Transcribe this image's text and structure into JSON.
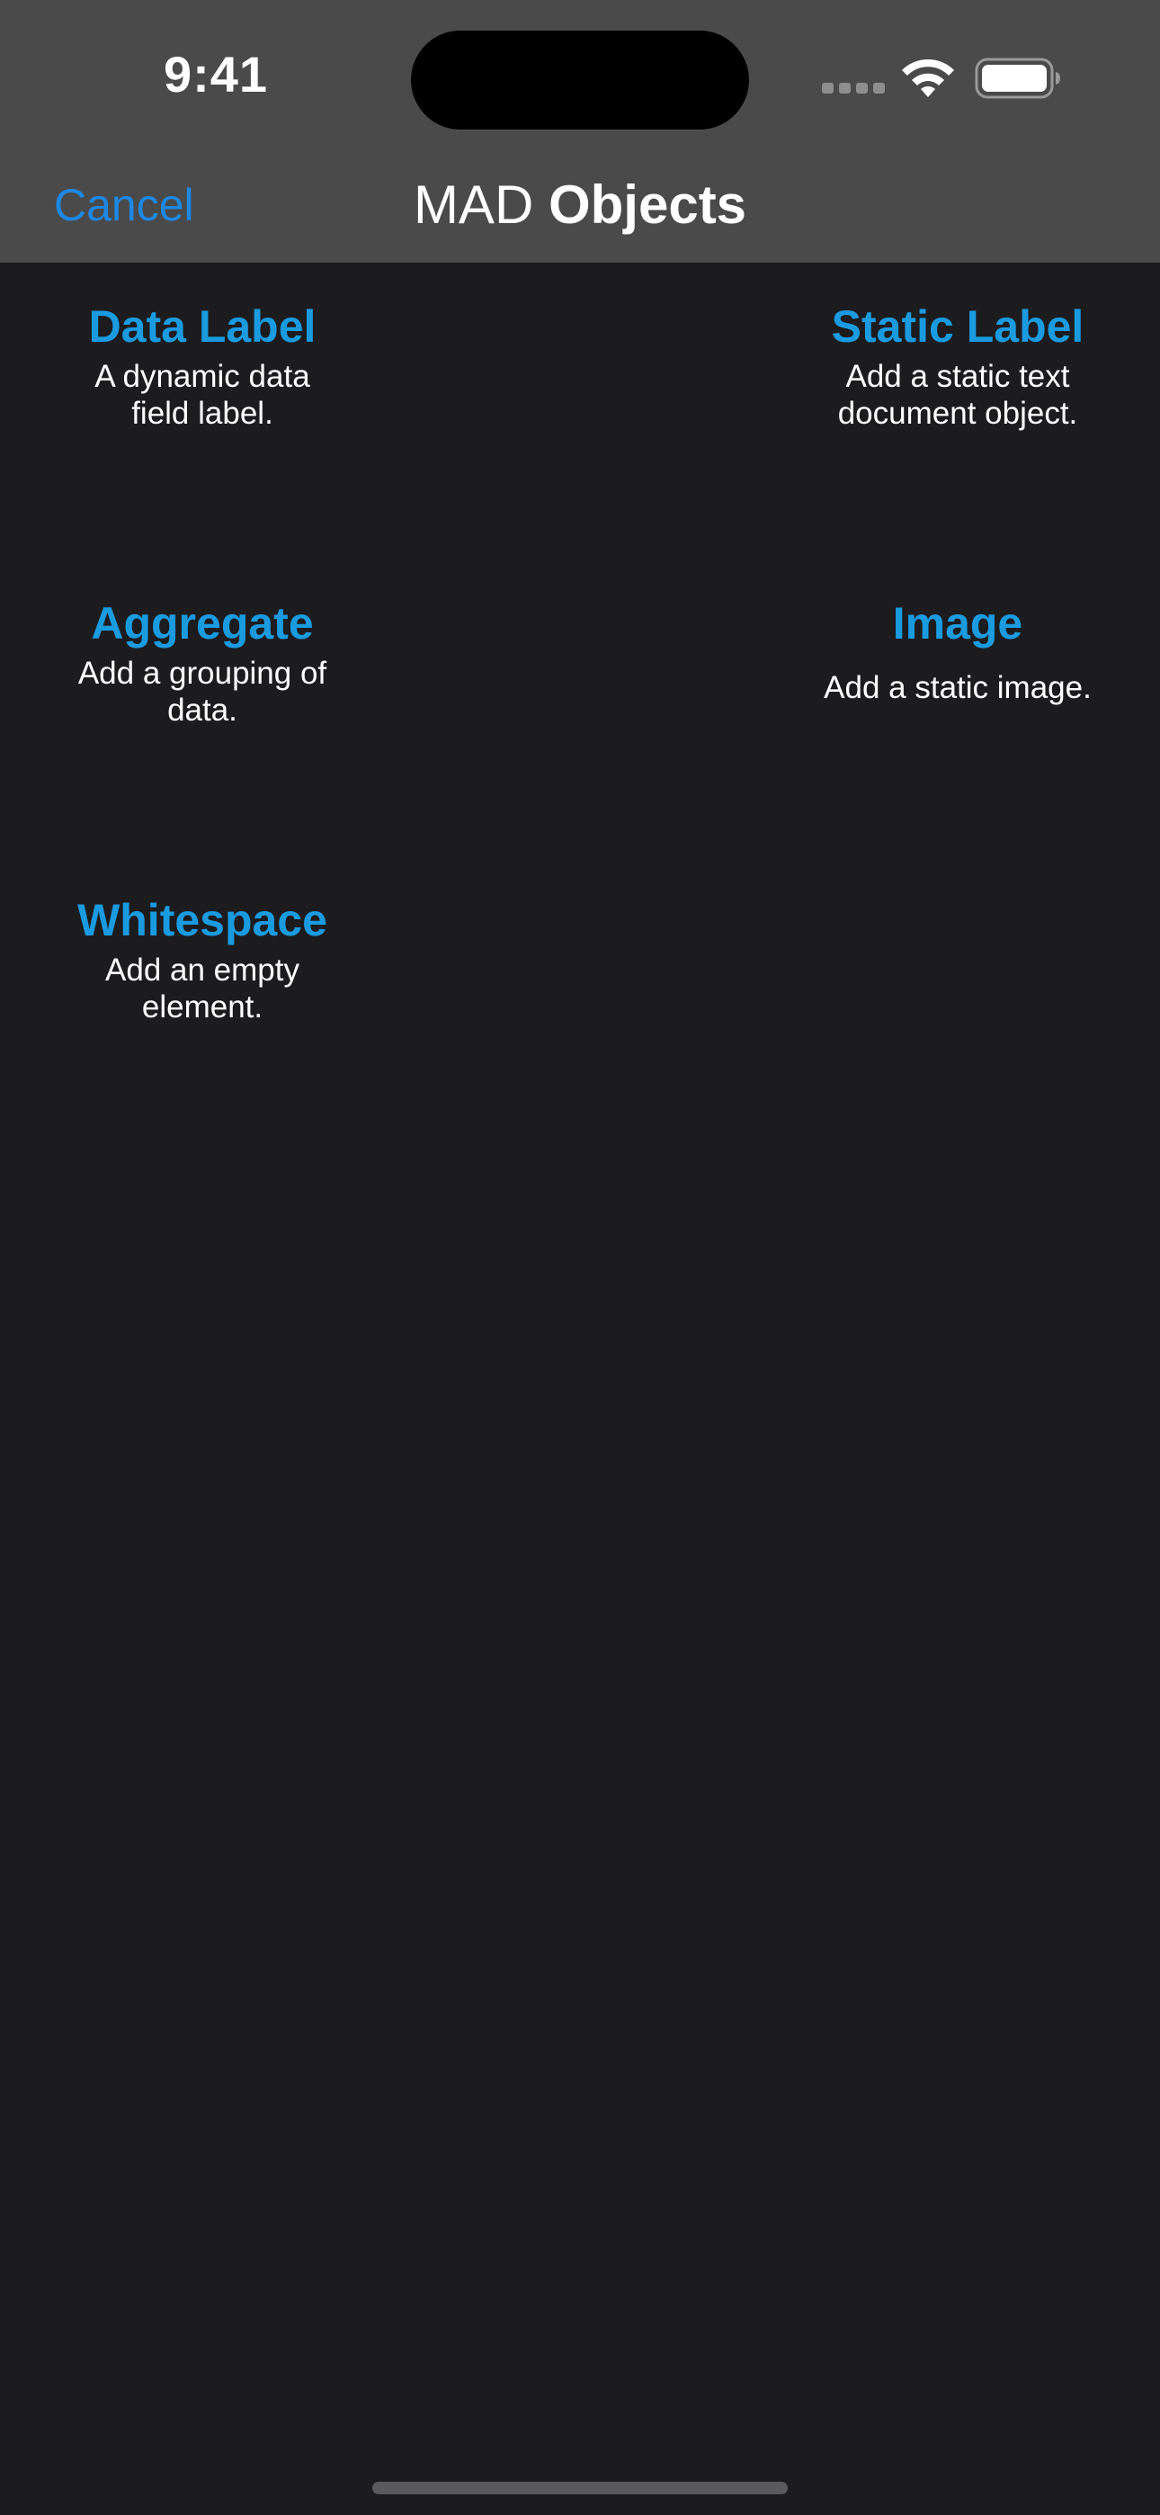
{
  "status_bar": {
    "time": "9:41"
  },
  "nav_bar": {
    "cancel_label": "Cancel",
    "title_prefix": "MAD",
    "title_main": "Objects"
  },
  "objects": [
    {
      "title": "Data Label",
      "description": "A dynamic data field label."
    },
    {
      "title": "Static Label",
      "description": "Add a static text document object."
    },
    {
      "title": "Aggregate",
      "description": "Add a grouping of data."
    },
    {
      "title": "Image",
      "description": "Add a static image."
    },
    {
      "title": "Whitespace",
      "description": "Add an empty element."
    }
  ],
  "colors": {
    "accent": "#1a9be0",
    "cancel": "#1e88e5",
    "background": "#1c1c1e",
    "header": "#4a4a4a"
  },
  "icons": [
    "cellular-signal-icon",
    "wifi-icon",
    "battery-icon"
  ]
}
